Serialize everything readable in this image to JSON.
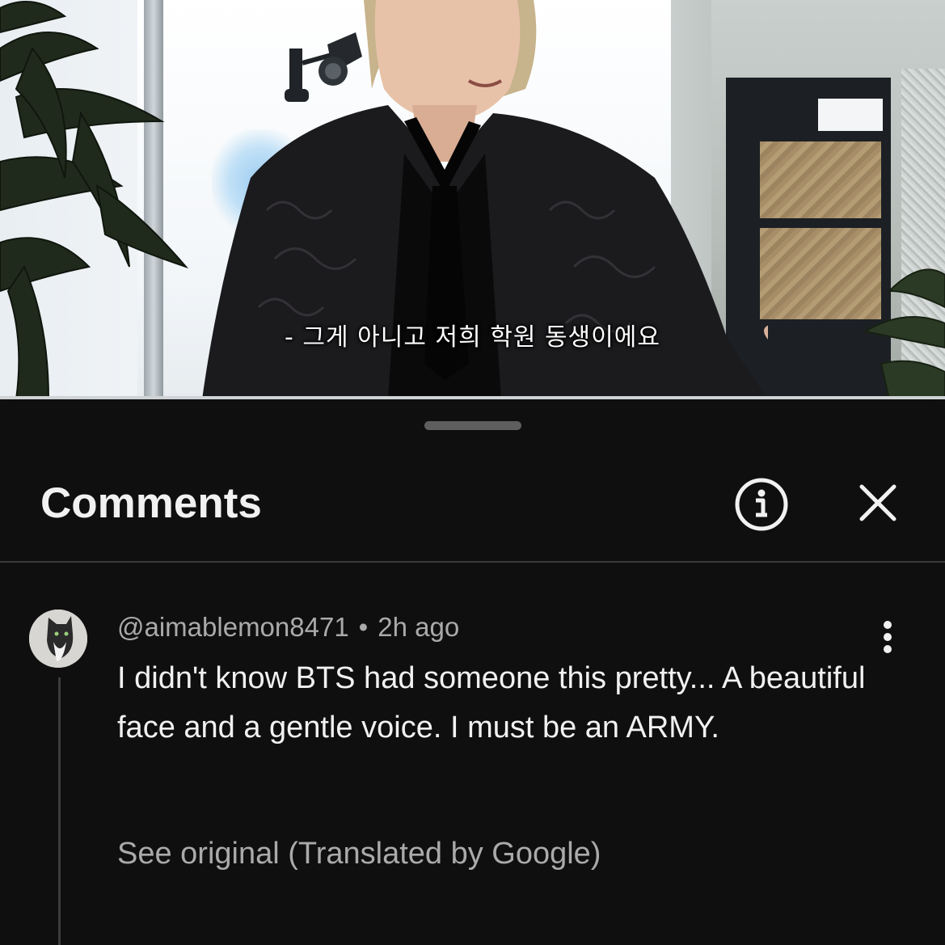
{
  "video": {
    "subtitle": "- 그게 아니고 저희 학원 동생이에요"
  },
  "comments_panel": {
    "title": "Comments",
    "info_icon": "info-circle-icon",
    "close_icon": "close-x-icon"
  },
  "comment": {
    "author": "@aimablemon8471",
    "separator": "•",
    "timestamp": "2h ago",
    "text": "I didn't know BTS had someone this pretty... A beautiful face and a gentle voice. I must be an ARMY.",
    "translation_link": "See original (Translated by Google)",
    "menu_icon": "more-vertical-icon"
  },
  "colors": {
    "background": "#0f0f0f",
    "primary_text": "#f1f1f1",
    "secondary_text": "#aaaaaa",
    "divider": "#3a3a3a"
  }
}
